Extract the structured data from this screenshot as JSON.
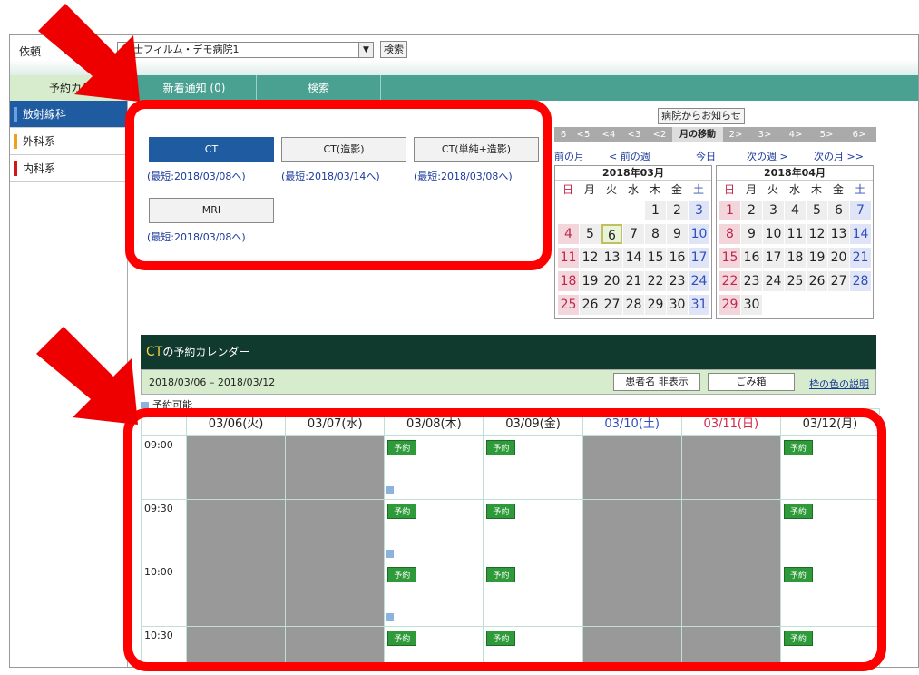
{
  "topbar": {
    "label": "依頼",
    "hospital_select": "富士フィルム・デモ病院1",
    "search_label": "検索"
  },
  "tabs": [
    {
      "label": "予約カレ"
    },
    {
      "label": "新着通知 (0)"
    },
    {
      "label": "検索"
    }
  ],
  "sidebar": {
    "items": [
      {
        "label": "放射線科",
        "mark_color": "#6aa0e0"
      },
      {
        "label": "外科系",
        "mark_color": "#f0a020"
      },
      {
        "label": "内科系",
        "mark_color": "#d01818"
      }
    ]
  },
  "notice_button": "病院からお知らせ",
  "month_nav": {
    "left": [
      "6",
      "<5",
      "<4",
      "<3",
      "<2"
    ],
    "center": "月の移動",
    "right": [
      "2>",
      "3>",
      "4>",
      "5>",
      "6>"
    ]
  },
  "week_nav": {
    "prev_month": "前の月",
    "prev_week": "< 前の週",
    "today": "今日",
    "next_week": "次の週 >",
    "next_month": "次の月 >>"
  },
  "calendars": [
    {
      "title": "2018年03月",
      "dow": [
        "日",
        "月",
        "火",
        "水",
        "木",
        "金",
        "土"
      ],
      "weeks": [
        [
          "",
          "",
          "",
          "",
          "1",
          "2",
          "3"
        ],
        [
          "4",
          "5",
          "6",
          "7",
          "8",
          "9",
          "10"
        ],
        [
          "11",
          "12",
          "13",
          "14",
          "15",
          "16",
          "17"
        ],
        [
          "18",
          "19",
          "20",
          "21",
          "22",
          "23",
          "24"
        ],
        [
          "25",
          "26",
          "27",
          "28",
          "29",
          "30",
          "31"
        ]
      ],
      "today": "6"
    },
    {
      "title": "2018年04月",
      "dow": [
        "日",
        "月",
        "火",
        "水",
        "木",
        "金",
        "土"
      ],
      "weeks": [
        [
          "1",
          "2",
          "3",
          "4",
          "5",
          "6",
          "7"
        ],
        [
          "8",
          "9",
          "10",
          "11",
          "12",
          "13",
          "14"
        ],
        [
          "15",
          "16",
          "17",
          "18",
          "19",
          "20",
          "21"
        ],
        [
          "22",
          "23",
          "24",
          "25",
          "26",
          "27",
          "28"
        ],
        [
          "29",
          "30",
          "",
          "",
          "",
          "",
          ""
        ]
      ],
      "today": ""
    }
  ],
  "modalities": [
    {
      "label": "CT",
      "note": "(最短:2018/03/08へ)",
      "selected": true
    },
    {
      "label": "CT(造影)",
      "note": "(最短:2018/03/14へ)",
      "selected": false
    },
    {
      "label": "CT(単純+造影)",
      "note": "(最短:2018/03/08へ)",
      "selected": false
    },
    {
      "label": "MRI",
      "note": "(最短:2018/03/08へ)",
      "selected": false
    }
  ],
  "booking": {
    "title_strong": "CT",
    "title_rest": "の予約カレンダー",
    "range": "2018/03/06 – 2018/03/12",
    "hide_patient_button": "患者名 非表示",
    "trash_button": "ごみ箱",
    "legend_link": "枠の色の説明",
    "legend_text": "予約可能",
    "columns": [
      {
        "label": "03/06(火)",
        "color": "#222"
      },
      {
        "label": "03/07(水)",
        "color": "#222"
      },
      {
        "label": "03/08(木)",
        "color": "#222"
      },
      {
        "label": "03/09(金)",
        "color": "#222"
      },
      {
        "label": "03/10(土)",
        "color": "#3050b8"
      },
      {
        "label": "03/11(日)",
        "color": "#d02848"
      },
      {
        "label": "03/12(月)",
        "color": "#222"
      }
    ],
    "reserve_label": "予約",
    "rows": [
      {
        "time": "09:00",
        "cells": [
          "gray",
          "gray",
          "rsv-info",
          "rsv",
          "gray",
          "gray",
          "rsv"
        ]
      },
      {
        "time": "09:30",
        "cells": [
          "gray",
          "gray",
          "rsv-info",
          "rsv",
          "gray",
          "gray",
          "rsv"
        ]
      },
      {
        "time": "10:00",
        "cells": [
          "gray",
          "gray",
          "rsv-info",
          "rsv",
          "gray",
          "gray",
          "rsv"
        ]
      },
      {
        "time": "10:30",
        "cells": [
          "gray",
          "gray",
          "rsv",
          "rsv",
          "gray",
          "gray",
          "rsv"
        ]
      }
    ]
  }
}
